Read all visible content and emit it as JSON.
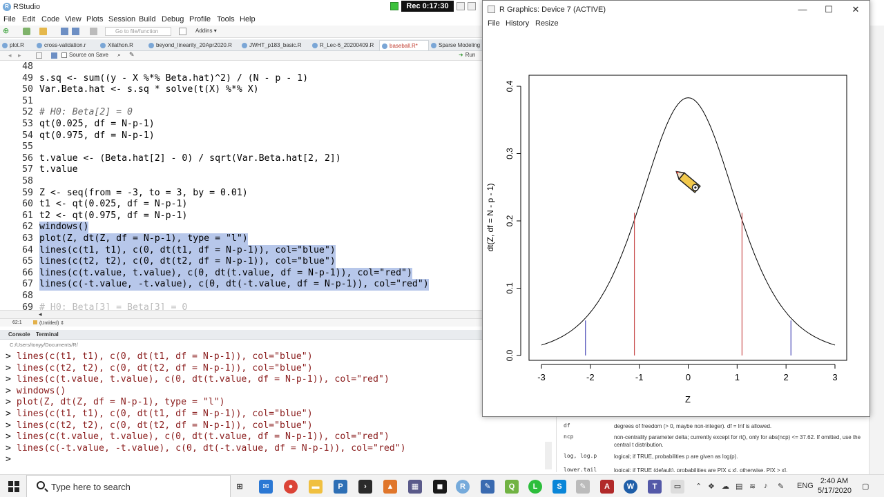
{
  "rstudio": {
    "title": "RStudio",
    "recording": "Rec 0:17:30",
    "menu": [
      "File",
      "Edit",
      "Code",
      "View",
      "Plots",
      "Session",
      "Build",
      "Debug",
      "Profile",
      "Tools",
      "Help"
    ],
    "toolbar": {
      "goto_placeholder": "Go to file/function",
      "addins_label": "Addins"
    },
    "tabs": [
      "plot.R",
      "cross-validation.r",
      "Xilathon.R",
      "beyond_linearity_20Apr2020.R",
      "JWHT_p183_basic.R",
      "R_Lec-6_20200409.R",
      "baseball.R*",
      "Sparse Modeling"
    ],
    "active_tab_index": 6,
    "editor_toolbar": {
      "source_on_save": "Source on Save",
      "run_label": "Run"
    },
    "editor": {
      "lines": [
        {
          "n": "48",
          "code": "",
          "sel": false,
          "style": ""
        },
        {
          "n": "49",
          "code": "s.sq <- sum((y - X %*% Beta.hat)^2) / (N - p - 1)",
          "sel": false,
          "style": ""
        },
        {
          "n": "50",
          "code": "Var.Beta.hat <- s.sq * solve(t(X) %*% X)",
          "sel": false,
          "style": ""
        },
        {
          "n": "51",
          "code": "",
          "sel": false,
          "style": ""
        },
        {
          "n": "52",
          "code": "# H0: Beta[2] = 0",
          "sel": false,
          "style": "comment"
        },
        {
          "n": "53",
          "code": "qt(0.025, df = N-p-1)",
          "sel": false,
          "style": ""
        },
        {
          "n": "54",
          "code": "qt(0.975, df = N-p-1)",
          "sel": false,
          "style": ""
        },
        {
          "n": "55",
          "code": "",
          "sel": false,
          "style": ""
        },
        {
          "n": "56",
          "code": "t.value <- (Beta.hat[2] - 0) / sqrt(Var.Beta.hat[2, 2])",
          "sel": false,
          "style": ""
        },
        {
          "n": "57",
          "code": "t.value",
          "sel": false,
          "style": ""
        },
        {
          "n": "58",
          "code": "",
          "sel": false,
          "style": ""
        },
        {
          "n": "59",
          "code": "Z <- seq(from = -3, to = 3, by = 0.01)",
          "sel": false,
          "style": ""
        },
        {
          "n": "60",
          "code": "t1 <- qt(0.025, df = N-p-1)",
          "sel": false,
          "style": ""
        },
        {
          "n": "61",
          "code": "t2 <- qt(0.975, df = N-p-1)",
          "sel": false,
          "style": ""
        },
        {
          "n": "62",
          "code": "windows()",
          "sel": true,
          "style": ""
        },
        {
          "n": "63",
          "code": "plot(Z, dt(Z, df = N-p-1), type = \"l\")",
          "sel": true,
          "style": ""
        },
        {
          "n": "64",
          "code": "lines(c(t1, t1), c(0, dt(t1, df = N-p-1)), col=\"blue\")",
          "sel": true,
          "style": ""
        },
        {
          "n": "65",
          "code": "lines(c(t2, t2), c(0, dt(t2, df = N-p-1)), col=\"blue\")",
          "sel": true,
          "style": ""
        },
        {
          "n": "66",
          "code": "lines(c(t.value, t.value), c(0, dt(t.value, df = N-p-1)), col=\"red\")",
          "sel": true,
          "style": ""
        },
        {
          "n": "67",
          "code": "lines(c(-t.value, -t.value), c(0, dt(-t.value, df = N-p-1)), col=\"red\")",
          "sel": true,
          "style": ""
        },
        {
          "n": "68",
          "code": "",
          "sel": false,
          "style": ""
        },
        {
          "n": "69",
          "code": "# H0: Beta[3] = Beta[3] = 0",
          "sel": false,
          "style": "faded"
        }
      ]
    },
    "status": {
      "position": "62:1",
      "file": "(Untitled)"
    },
    "console_tabs": [
      "Console",
      "Terminal"
    ],
    "console_path": "C:/Users/tonyy/Documents/R/",
    "console_lines": [
      "lines(c(t1, t1), c(0, dt(t1, df = N-p-1)), col=\"blue\")",
      "lines(c(t2, t2), c(0, dt(t2, df = N-p-1)), col=\"blue\")",
      "lines(c(t.value, t.value), c(0, dt(t.value, df = N-p-1)), col=\"red\")",
      "windows()",
      "plot(Z, dt(Z, df = N-p-1), type = \"l\")",
      "lines(c(t1, t1), c(0, dt(t1, df = N-p-1)), col=\"blue\")",
      "lines(c(t2, t2), c(0, dt(t2, df = N-p-1)), col=\"blue\")",
      "lines(c(t.value, t.value), c(0, dt(t.value, df = N-p-1)), col=\"red\")",
      "lines(c(-t.value, -t.value), c(0, dt(-t.value, df = N-p-1)), col=\"red\")",
      ""
    ],
    "prompt": ">",
    "help": [
      {
        "key": "df",
        "text": "degrees of freedom (> 0, maybe non-integer). df = Inf is allowed."
      },
      {
        "key": "ncp",
        "text": "non-centrality parameter delta; currently except for rt(), only for abs(ncp) <= 37.62. If omitted, use the central t distribution."
      },
      {
        "key": "log, log.p",
        "text": "logical; if TRUE, probabilities p are given as log(p)."
      },
      {
        "key": "lower.tail",
        "text": "logical; if TRUE (default), probabilities are P[X ≤ x], otherwise, P[X > x]."
      }
    ]
  },
  "graphics_window": {
    "title": "R Graphics: Device 7 (ACTIVE)",
    "menu": [
      "File",
      "History",
      "Resize"
    ],
    "window_buttons": [
      "—",
      "☐",
      "✕"
    ]
  },
  "chart_data": {
    "type": "line",
    "title": "",
    "xlabel": "Z",
    "ylabel": "dt(Z, df = N - p - 1)",
    "xlim": [
      -3,
      3
    ],
    "ylim": [
      0,
      0.4
    ],
    "xticks": [
      "-3",
      "-2",
      "-1",
      "0",
      "1",
      "2",
      "3"
    ],
    "yticks": [
      "0.0",
      "0.1",
      "0.2",
      "0.3",
      "0.4"
    ],
    "series": [
      {
        "color": "#000000",
        "x_from": -3,
        "x_to": 3,
        "step": 0.05,
        "df": 6,
        "y_peak": 0.383
      }
    ],
    "vertical_lines": [
      {
        "x": -2.1,
        "y": 0.052,
        "color": "#4a4ab8"
      },
      {
        "x": 2.1,
        "y": 0.052,
        "color": "#4a4ab8"
      },
      {
        "x": -1.1,
        "y": 0.212,
        "color": "#c84a4a"
      },
      {
        "x": 1.1,
        "y": 0.212,
        "color": "#c84a4a"
      }
    ],
    "grid": false
  },
  "taskbar": {
    "search_placeholder": "Type here to search",
    "language": "ENG",
    "time": "2:40 AM",
    "date": "5/17/2020"
  }
}
